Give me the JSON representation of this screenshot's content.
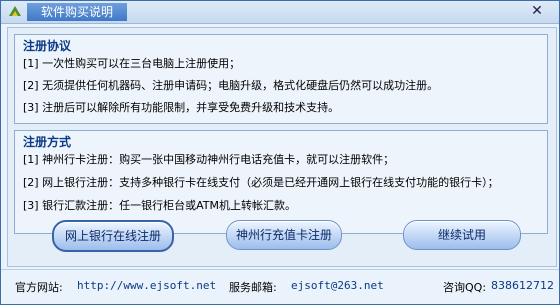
{
  "window": {
    "title": "软件购买说明"
  },
  "agreement": {
    "title": "注册协议",
    "items": [
      "[1] 一次性购买可以在三台电脑上注册使用；",
      "[2] 无须提供任何机器码、注册申请码；电脑升级，格式化硬盘后仍然可以成功注册。",
      "[3] 注册后可以解除所有功能限制，并享受免费升级和技术支持。"
    ]
  },
  "methods": {
    "title": "注册方式",
    "items": [
      "[1] 神州行卡注册：购买一张中国移动神州行电话充值卡，就可以注册软件；",
      "[2] 网上银行注册：支持多种银行卡在线支付（必须是已经开通网上银行在线支付功能的银行卡）；",
      "[3] 银行汇款注册：任一银行柜台或ATM机上转帐汇款。"
    ]
  },
  "buttons": {
    "online_bank": "网上银行在线注册",
    "card": "神州行充值卡注册",
    "trial": "继续试用"
  },
  "footer": {
    "site_label": "官方网站:",
    "site_value": "http://www.ejsoft.net",
    "email_label": "服务邮箱:",
    "email_value": "ejsoft@263.net",
    "qq_label": "咨询QQ:",
    "qq_value": "838612712"
  },
  "colors": {
    "title_bar": "#3f78c6",
    "group_title": "#0a3a86",
    "border": "#8eadd3"
  }
}
